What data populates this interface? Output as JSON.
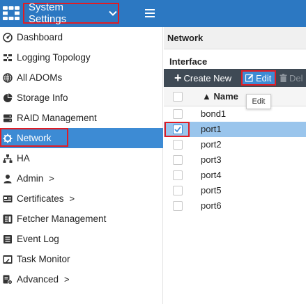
{
  "topbar": {
    "app_menu_label": "System Settings",
    "accent_color": "#2c78c2",
    "logo_icon": "fortinet-grid-icon",
    "menu_icon": "hamburger-icon"
  },
  "sidebar": {
    "items": [
      {
        "label": "Dashboard",
        "icon": "dashboard-icon"
      },
      {
        "label": "Logging Topology",
        "icon": "topology-icon"
      },
      {
        "label": "All ADOMs",
        "icon": "globe-icon"
      },
      {
        "label": "Storage Info",
        "icon": "pie-chart-icon"
      },
      {
        "label": "RAID Management",
        "icon": "raid-icon"
      },
      {
        "label": "Network",
        "icon": "network-icon",
        "active": true
      },
      {
        "label": "HA",
        "icon": "sitemap-icon"
      },
      {
        "label": "Admin",
        "icon": "user-icon",
        "arrow": ">"
      },
      {
        "label": "Certificates",
        "icon": "certificate-icon",
        "arrow": ">"
      },
      {
        "label": "Fetcher Management",
        "icon": "fetcher-icon"
      },
      {
        "label": "Event Log",
        "icon": "list-icon"
      },
      {
        "label": "Task Monitor",
        "icon": "monitor-icon"
      },
      {
        "label": "Advanced",
        "icon": "settings-doc-icon",
        "arrow": ">"
      }
    ],
    "active_color": "#3d8bd4"
  },
  "main": {
    "page_title": "Network",
    "section_title": "Interface",
    "toolbar": {
      "create_label": "Create New",
      "edit_label": "Edit",
      "delete_label": "Del"
    },
    "tooltip": "Edit",
    "table": {
      "name_header": "Name",
      "sort_glyph": "▲",
      "rows": [
        {
          "name": "bond1",
          "checked": false
        },
        {
          "name": "port1",
          "checked": true
        },
        {
          "name": "port2",
          "checked": false
        },
        {
          "name": "port3",
          "checked": false
        },
        {
          "name": "port4",
          "checked": false
        },
        {
          "name": "port5",
          "checked": false
        },
        {
          "name": "port6",
          "checked": false
        }
      ]
    },
    "highlight_color": "#e01c24"
  }
}
